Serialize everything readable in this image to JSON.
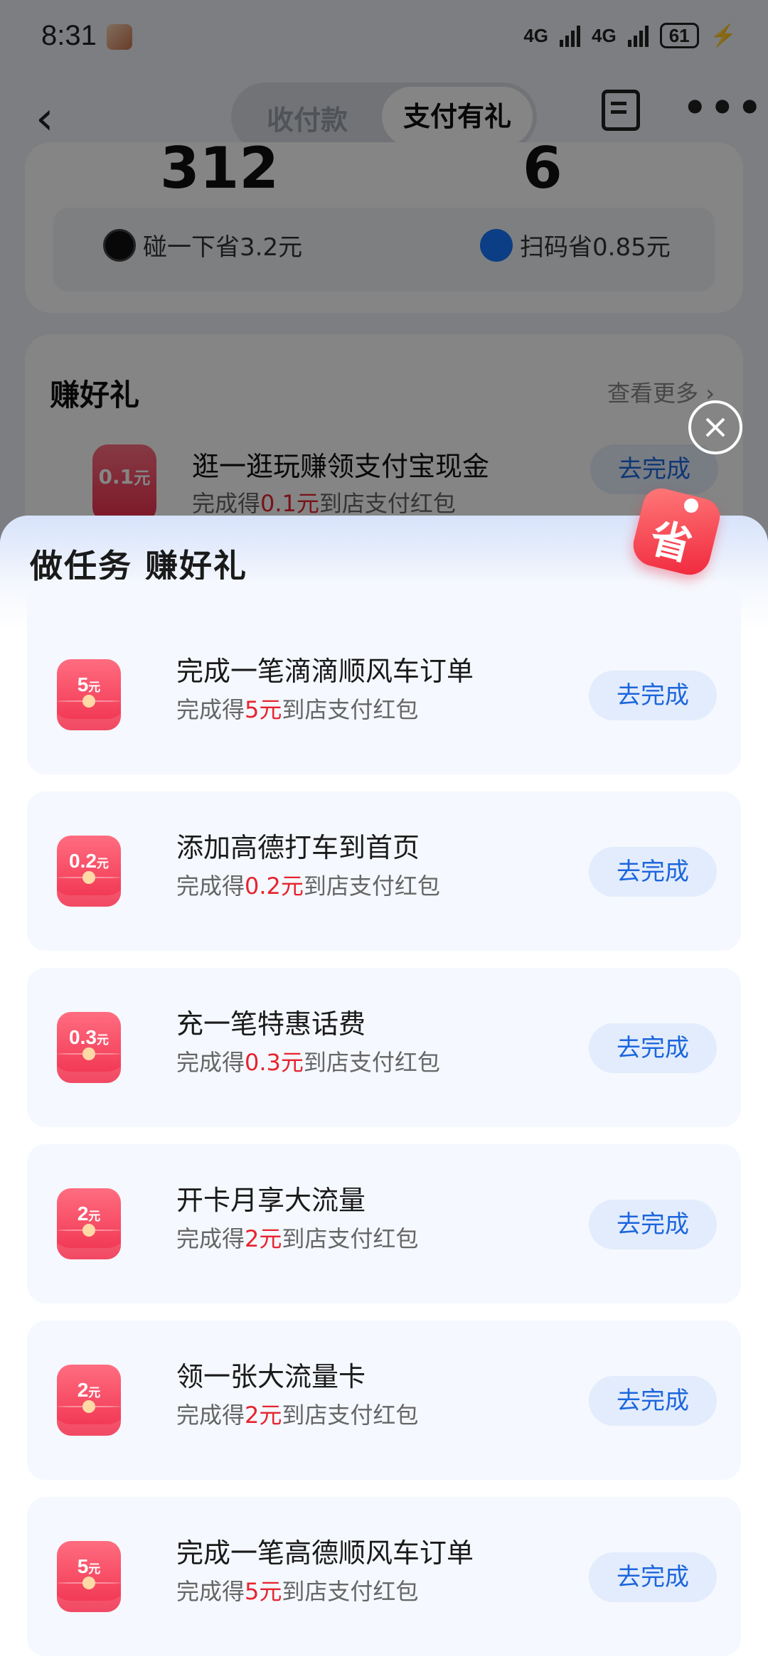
{
  "status_bar": {
    "time": "8:31",
    "net1": "4G",
    "net2": "4G",
    "battery": "61"
  },
  "nav": {
    "tab_inactive": "收付款",
    "tab_active": "支付有礼"
  },
  "summary": {
    "big_left": "312",
    "big_right": "6",
    "save_tap": "碰一下省3.2元",
    "save_scan": "扫码省0.85元"
  },
  "earn": {
    "heading": "赚好礼",
    "see_more": "查看更多 ›",
    "row": {
      "badge_amount": "0.1",
      "badge_unit": "元",
      "title": "逛一逛玩赚领支付宝现金",
      "sub_prefix": "完成得",
      "sub_amount": "0.1元",
      "sub_suffix": "到店支付红包",
      "button": "去完成"
    }
  },
  "sheet": {
    "title": "做任务 赚好礼",
    "tag_char": "省",
    "tasks": [
      {
        "badge_amount": "5",
        "badge_unit": "元",
        "title": "完成一笔滴滴顺风车订单",
        "sub_prefix": "完成得",
        "sub_amount": "5元",
        "sub_suffix": "到店支付红包",
        "button": "去完成"
      },
      {
        "badge_amount": "0.2",
        "badge_unit": "元",
        "title": "添加高德打车到首页",
        "sub_prefix": "完成得",
        "sub_amount": "0.2元",
        "sub_suffix": "到店支付红包",
        "button": "去完成"
      },
      {
        "badge_amount": "0.3",
        "badge_unit": "元",
        "title": "充一笔特惠话费",
        "sub_prefix": "完成得",
        "sub_amount": "0.3元",
        "sub_suffix": "到店支付红包",
        "button": "去完成"
      },
      {
        "badge_amount": "2",
        "badge_unit": "元",
        "title": "开卡月享大流量",
        "sub_prefix": "完成得",
        "sub_amount": "2元",
        "sub_suffix": "到店支付红包",
        "button": "去完成"
      },
      {
        "badge_amount": "2",
        "badge_unit": "元",
        "title": "领一张大流量卡",
        "sub_prefix": "完成得",
        "sub_amount": "2元",
        "sub_suffix": "到店支付红包",
        "button": "去完成"
      },
      {
        "badge_amount": "5",
        "badge_unit": "元",
        "title": "完成一笔高德顺风车订单",
        "sub_prefix": "完成得",
        "sub_amount": "5元",
        "sub_suffix": "到店支付红包",
        "button": "去完成"
      }
    ]
  },
  "colors": {
    "accent_blue": "#1c66dd",
    "red_amount": "#e6242f",
    "packet_red": "#f0304e"
  }
}
